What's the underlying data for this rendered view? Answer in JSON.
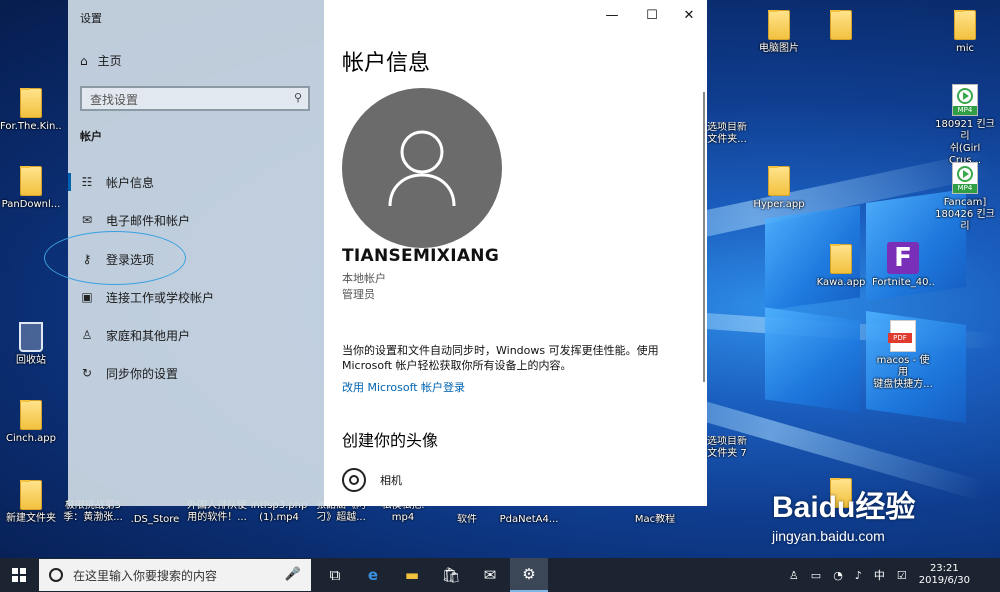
{
  "desktop": {
    "icons_left": [
      {
        "label": "For.The.Kin...",
        "type": "folder"
      },
      {
        "label": "PanDownl...",
        "type": "folder"
      },
      {
        "label": "回收站",
        "type": "recycle"
      },
      {
        "label": "Cinch.app",
        "type": "folder"
      },
      {
        "label": "新建文件夹",
        "type": "folder"
      }
    ],
    "icons_right": [
      {
        "label": "电脑图片",
        "type": "folder"
      },
      {
        "label": "mic",
        "type": "folder"
      },
      {
        "label": "选项目新\n文件夹...",
        "type": "folder"
      },
      {
        "label": "180921 킨크리\n쉬(Girl Crus...",
        "type": "mp4"
      },
      {
        "label": "Hyper.app",
        "type": "folder"
      },
      {
        "label": "Fancam]\n180426 킨크리",
        "type": "mp4"
      },
      {
        "label": "Kawa.app",
        "type": "folder"
      },
      {
        "label": "Fortnite_40...",
        "type": "fortnite"
      },
      {
        "label": "macos - 使用\n键盘快捷方...",
        "type": "pdf"
      },
      {
        "label": "选项目新\n文件夹 7",
        "type": "folder"
      },
      {
        "label": "Baidu",
        "type": "folder"
      }
    ],
    "icons_bottom": [
      {
        "label": "极限挑战第5\n季：黄渤张...",
        "type": "mp4"
      },
      {
        "label": ".DS_Store",
        "type": "file"
      },
      {
        "label": "外国人排队使\n用的软件！...",
        "type": "mp4"
      },
      {
        "label": "intfsp3.php\n(1).mp4",
        "type": "mp4"
      },
      {
        "label": "张韶涵《阿\n刁》超越...",
        "type": "mp4"
      },
      {
        "label": "私模私把.\nmp4",
        "type": "mp4"
      },
      {
        "label": "软件",
        "type": "folder"
      },
      {
        "label": "PdaNetA4...",
        "type": "folder"
      },
      {
        "label": "Mac教程",
        "type": "folder"
      }
    ]
  },
  "settings": {
    "window_title": "设置",
    "home": "主页",
    "search_placeholder": "查找设置",
    "section": "帐户",
    "nav": [
      {
        "label": "帐户信息",
        "icon": "account-info-icon"
      },
      {
        "label": "电子邮件和帐户",
        "icon": "mail-icon"
      },
      {
        "label": "登录选项",
        "icon": "key-icon"
      },
      {
        "label": "连接工作或学校帐户",
        "icon": "briefcase-icon"
      },
      {
        "label": "家庭和其他用户",
        "icon": "person-add-icon"
      },
      {
        "label": "同步你的设置",
        "icon": "sync-icon"
      }
    ],
    "main": {
      "title": "帐户信息",
      "username": "TIANSEMIXIANG",
      "account_type": "本地帐户",
      "role": "管理员",
      "sync_desc": "当你的设置和文件自动同步时，Windows 可发挥更佳性能。使用 Microsoft 帐户轻松获取你所有设备上的内容。",
      "ms_link": "改用 Microsoft 帐户登录",
      "create_avatar": "创建你的头像",
      "camera": "相机"
    }
  },
  "taskbar": {
    "search_placeholder": "在这里输入你要搜索的内容",
    "ime": "中",
    "time": "23:21",
    "date": "2019/6/30"
  },
  "watermark": {
    "logo": "Baidu经验",
    "url": "jingyan.baidu.com"
  }
}
